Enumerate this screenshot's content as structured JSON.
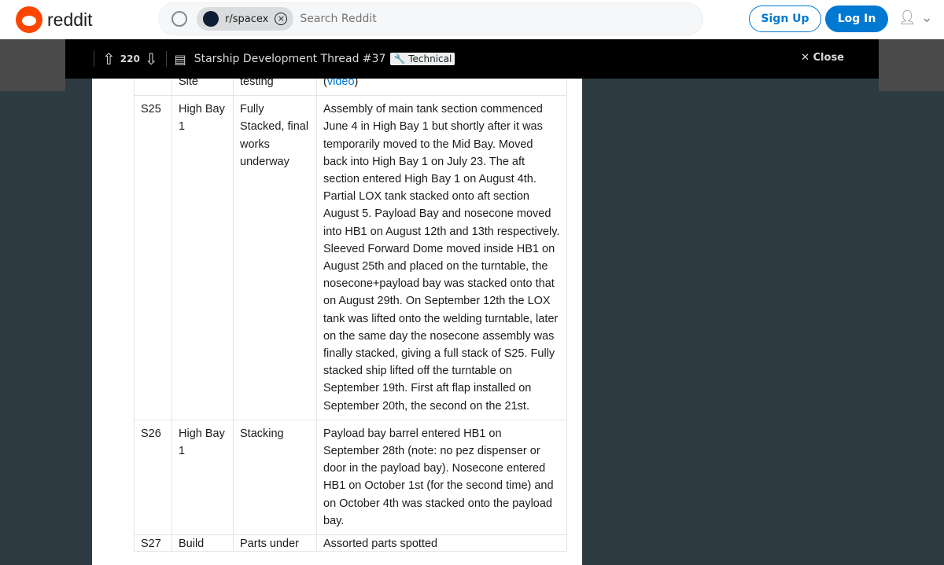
{
  "header": {
    "logo": "reddit",
    "subreddit_chip": "r/spacex",
    "search_placeholder": "Search Reddit",
    "sign_up": "Sign Up",
    "log_in": "Log In"
  },
  "post_bar": {
    "votes": "220",
    "title": "Starship Development Thread #37",
    "flair": "🔧 Technical",
    "close": "Close"
  },
  "table": {
    "rows": [
      {
        "c1": "",
        "c2": "Site",
        "c3": "testing",
        "c4_pre": "(",
        "c4_link": "video",
        "c4_post": ")"
      },
      {
        "c1": "S25",
        "c2": "High Bay 1",
        "c3": "Fully Stacked, final works underway",
        "c4": "Assembly of main tank section commenced June 4 in High Bay 1 but shortly after it was temporarily moved to the Mid Bay. Moved back into High Bay 1 on July 23. The aft section entered High Bay 1 on August 4th. Partial LOX tank stacked onto aft section August 5. Payload Bay and nosecone moved into HB1 on August 12th and 13th respectively. Sleeved Forward Dome moved inside HB1 on August 25th and placed on the turntable, the nosecone+payload bay was stacked onto that on August 29th. On September 12th the LOX tank was lifted onto the welding turntable, later on the same day the nosecone assembly was finally stacked, giving a full stack of S25. Fully stacked ship lifted off the turntable on September 19th. First aft flap installed on September 20th, the second on the 21st."
      },
      {
        "c1": "S26",
        "c2": "High Bay 1",
        "c3": "Stacking",
        "c4": "Payload bay barrel entered HB1 on September 28th (note: no pez dispenser or door in the payload bay). Nosecone entered HB1 on October 1st (for the second time) and on October 4th was stacked onto the payload bay."
      },
      {
        "c1": "S27",
        "c2": "Build",
        "c3": "Parts under",
        "c4": "Assorted parts spotted"
      }
    ]
  }
}
